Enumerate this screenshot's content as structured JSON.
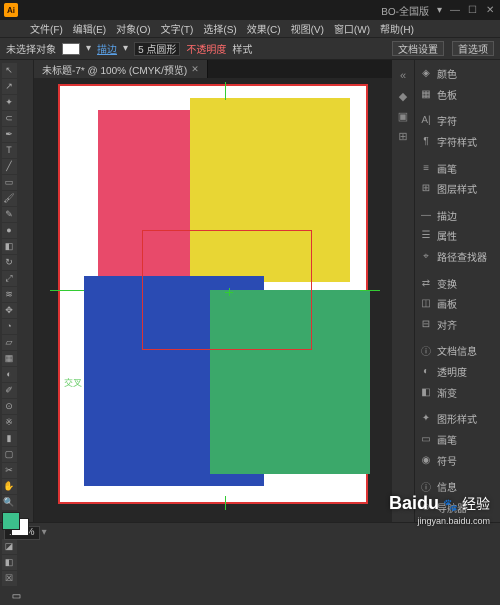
{
  "titlebar": {
    "window_label": "BO-全国版",
    "min_icon": "—",
    "max_icon": "☐",
    "close_icon": "✕"
  },
  "menu": {
    "file": "文件(F)",
    "edit": "编辑(E)",
    "object": "对象(O)",
    "type": "文字(T)",
    "select": "选择(S)",
    "effect": "效果(C)",
    "view": "视图(V)",
    "window": "窗口(W)",
    "help": "帮助(H)"
  },
  "options": {
    "no_selection": "未选择对象",
    "stroke_link": "描边",
    "stroke_pt": "5 点圆形",
    "opacity_label": "不透明度",
    "style_label": "样式",
    "doc_setup": "文档设置",
    "prefs": "首选项"
  },
  "tab": {
    "label": "未标题-7* @ 100% (CMYK/预览)",
    "close": "✕"
  },
  "canvas": {
    "guide_label": "交叉"
  },
  "panels": [
    {
      "icon": "◈",
      "label": "颜色"
    },
    {
      "icon": "▦",
      "label": "色板"
    },
    {
      "icon": "A|",
      "label": "字符"
    },
    {
      "icon": "¶",
      "label": "字符样式"
    },
    {
      "icon": "≡",
      "label": "画笔"
    },
    {
      "icon": "⊞",
      "label": "图层样式"
    },
    {
      "icon": "—",
      "label": "描边"
    },
    {
      "icon": "☰",
      "label": "属性"
    },
    {
      "icon": "⌖",
      "label": "路径查找器"
    },
    {
      "icon": "⇄",
      "label": "变换"
    },
    {
      "icon": "◫",
      "label": "画板"
    },
    {
      "icon": "⊟",
      "label": "对齐"
    },
    {
      "icon": "ⓘ",
      "label": "文档信息"
    },
    {
      "icon": "◐",
      "label": "透明度"
    },
    {
      "icon": "◧",
      "label": "渐变"
    },
    {
      "icon": "✦",
      "label": "图形样式"
    },
    {
      "icon": "▭",
      "label": "画笔"
    },
    {
      "icon": "◉",
      "label": "符号"
    },
    {
      "icon": "ⓘ",
      "label": "信息"
    },
    {
      "icon": "⊕",
      "label": "导航器"
    }
  ],
  "statusbar": {
    "zoom": "100%"
  },
  "watermark": {
    "brand": "Baidu",
    "word": "经验",
    "sub": "jingyan.baidu.com"
  }
}
